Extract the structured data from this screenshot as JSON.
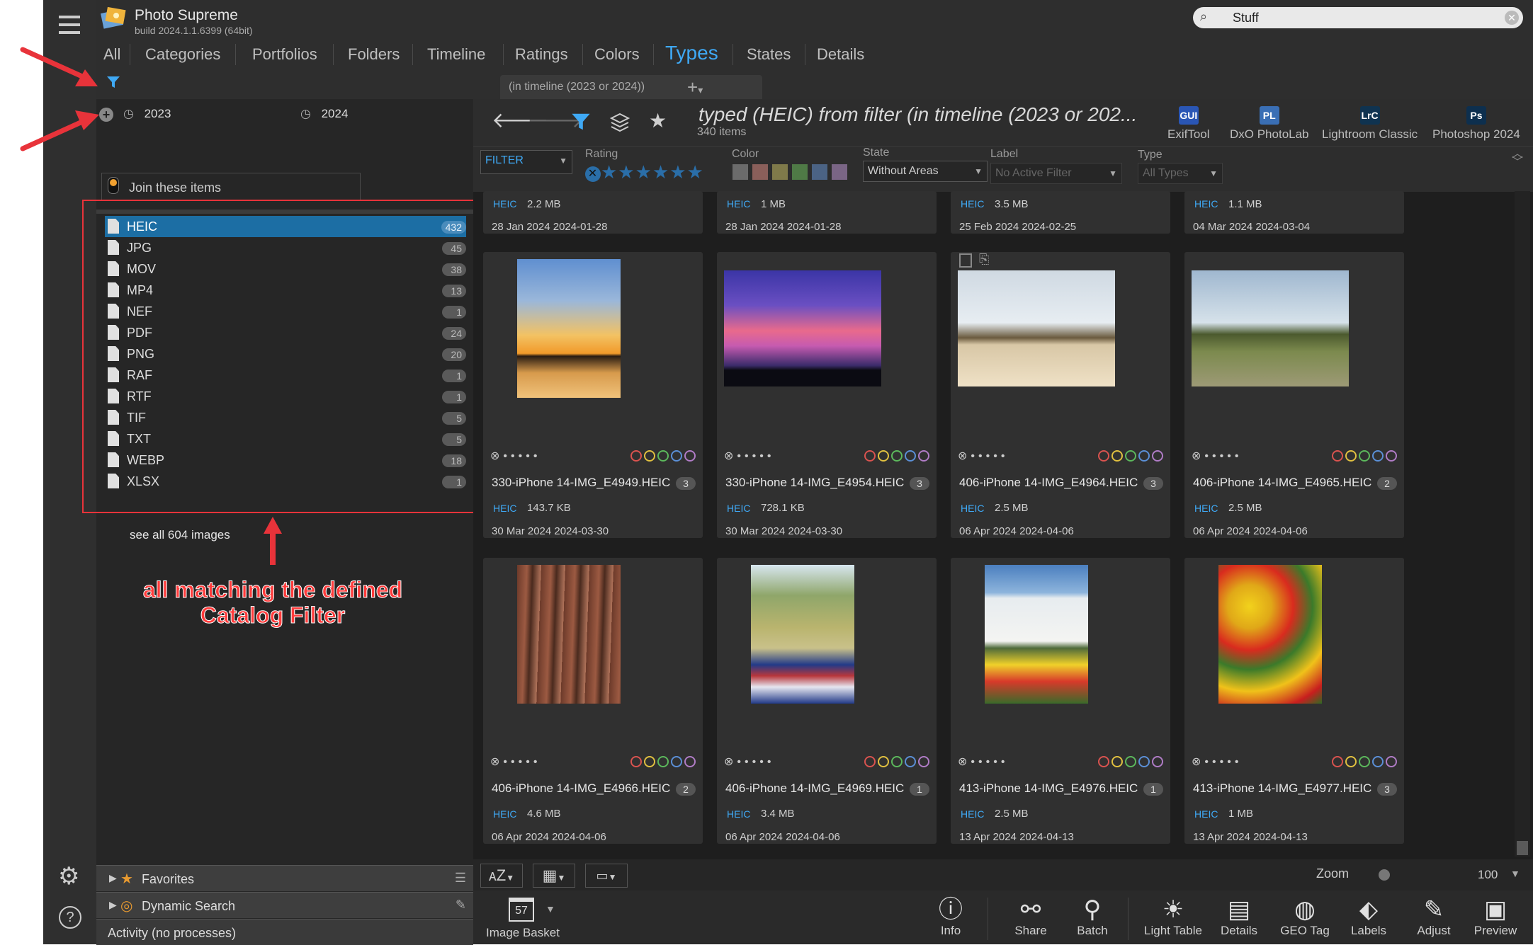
{
  "app": {
    "title": "Photo Supreme",
    "build": "build 2024.1.1.6399 (64bit)"
  },
  "search": {
    "value": "Stuff"
  },
  "nav_tabs": [
    "All",
    "Categories",
    "Portfolios",
    "Folders",
    "Timeline",
    "Ratings",
    "Colors",
    "Types",
    "States",
    "Details"
  ],
  "active_tab": "Types",
  "left": {
    "years": [
      "2023",
      "2024"
    ],
    "join_label": "Join these items",
    "types": [
      {
        "label": "HEIC",
        "count": "432"
      },
      {
        "label": "JPG",
        "count": "45"
      },
      {
        "label": "MOV",
        "count": "38"
      },
      {
        "label": "MP4",
        "count": "13"
      },
      {
        "label": "NEF",
        "count": "1"
      },
      {
        "label": "PDF",
        "count": "24"
      },
      {
        "label": "PNG",
        "count": "20"
      },
      {
        "label": "RAF",
        "count": "1"
      },
      {
        "label": "RTF",
        "count": "1"
      },
      {
        "label": "TIF",
        "count": "5"
      },
      {
        "label": "TXT",
        "count": "5"
      },
      {
        "label": "WEBP",
        "count": "18"
      },
      {
        "label": "XLSX",
        "count": "1"
      }
    ],
    "see_all": "see all 604 images",
    "annotation": "all matching the defined Catalog Filter",
    "favorites": "Favorites",
    "dynamic_search": "Dynamic Search",
    "activity": "Activity (no processes)"
  },
  "main": {
    "filter_tab": "(in timeline (2023 or 2024))",
    "title": "typed (HEIC) from filter (in timeline (2023 or 202...",
    "count": "340 items",
    "ext_apps": [
      {
        "label": "ExifTool",
        "badge": "GUI",
        "color": "#2a56b5"
      },
      {
        "label": "DxO PhotoLab",
        "badge": "PL",
        "color": "#3a6fb5"
      },
      {
        "label": "Lightroom Classic",
        "badge": "LrC",
        "color": "#0f3350"
      },
      {
        "label": "Photoshop 2024",
        "badge": "Ps",
        "color": "#0d2f4e"
      }
    ],
    "filterbar": {
      "filter_label": "FILTER",
      "rating_label": "Rating",
      "color_label": "Color",
      "state_label": "State",
      "state_value": "Without Areas",
      "label_label": "Label",
      "label_value": "No Active Filter",
      "type_label": "Type",
      "type_value": "All Types",
      "swatch_colors": [
        "#6b6b6b",
        "#8a5f5a",
        "#7f7a4a",
        "#4f7a46",
        "#4b6384",
        "#7a6585"
      ]
    },
    "top_row": [
      {
        "type": "HEIC",
        "size": "2.2 MB",
        "dates": "28 Jan 2024  2024-01-28"
      },
      {
        "type": "HEIC",
        "size": "1 MB",
        "dates": "28 Jan 2024  2024-01-28"
      },
      {
        "type": "HEIC",
        "size": "3.5 MB",
        "dates": "25 Feb 2024  2024-02-25"
      },
      {
        "type": "HEIC",
        "size": "1.1 MB",
        "dates": "04 Mar 2024  2024-03-04"
      }
    ],
    "cards": [
      {
        "name": "330-iPhone 14-IMG_E4949.HEIC",
        "ver": "3",
        "type": "HEIC",
        "size": "143.7 KB",
        "dates": "30 Mar 2024  2024-03-30"
      },
      {
        "name": "330-iPhone 14-IMG_E4954.HEIC",
        "ver": "3",
        "type": "HEIC",
        "size": "728.1 KB",
        "dates": "30 Mar 2024  2024-03-30"
      },
      {
        "name": "406-iPhone 14-IMG_E4964.HEIC",
        "ver": "3",
        "type": "HEIC",
        "size": "2.5 MB",
        "dates": "06 Apr 2024  2024-04-06"
      },
      {
        "name": "406-iPhone 14-IMG_E4965.HEIC",
        "ver": "2",
        "type": "HEIC",
        "size": "2.5 MB",
        "dates": "06 Apr 2024  2024-04-06"
      },
      {
        "name": "406-iPhone 14-IMG_E4966.HEIC",
        "ver": "2",
        "type": "HEIC",
        "size": "4.6 MB",
        "dates": "06 Apr 2024  2024-04-06"
      },
      {
        "name": "406-iPhone 14-IMG_E4969.HEIC",
        "ver": "1",
        "type": "HEIC",
        "size": "3.4 MB",
        "dates": "06 Apr 2024  2024-04-06"
      },
      {
        "name": "413-iPhone 14-IMG_E4976.HEIC",
        "ver": "1",
        "type": "HEIC",
        "size": "2.5 MB",
        "dates": "13 Apr 2024  2024-04-13"
      },
      {
        "name": "413-iPhone 14-IMG_E4977.HEIC",
        "ver": "3",
        "type": "HEIC",
        "size": "1 MB",
        "dates": "13 Apr 2024  2024-04-13"
      }
    ],
    "ring_colors": [
      "#d9534f",
      "#e0c040",
      "#5cb85c",
      "#5b8fd6",
      "#b07cc6"
    ],
    "zoom_label": "Zoom",
    "zoom_value": "100"
  },
  "bottom": {
    "basket_label": "Image Basket",
    "basket_day": "57",
    "items": [
      "Info",
      "Share",
      "Batch",
      "Light Table",
      "Details",
      "GEO Tag",
      "Labels",
      "Adjust",
      "Preview"
    ]
  }
}
